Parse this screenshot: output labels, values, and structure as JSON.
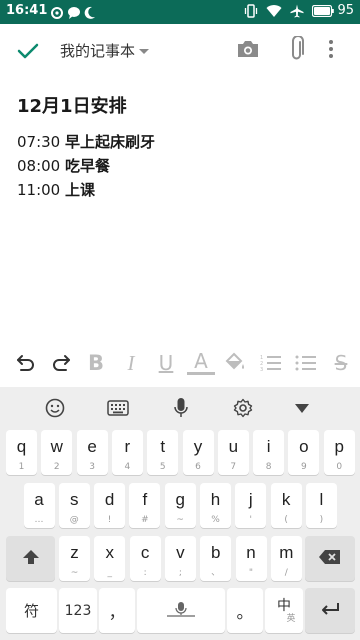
{
  "status_bar": {
    "time": "16:41",
    "battery": "95",
    "left_icons": [
      "sync-icon",
      "chat-bubble-icon",
      "moon-icon"
    ],
    "right_icons": [
      "vibrate-icon",
      "wifi-icon",
      "airplane-icon",
      "battery-icon"
    ]
  },
  "toolbar": {
    "notebook_name": "我的记事本",
    "icons": [
      "check-icon",
      "dropdown-caret-icon",
      "camera-icon",
      "paperclip-icon",
      "more-vert-icon"
    ]
  },
  "note": {
    "title": "12月1日安排",
    "lines": [
      {
        "time": "07:30",
        "task": "早上起床刷牙"
      },
      {
        "time": "08:00",
        "task": "吃早餐"
      },
      {
        "time": "11:00",
        "task": "上课"
      }
    ]
  },
  "format_bar": {
    "icons": [
      "undo-icon",
      "redo-icon",
      "bold-icon",
      "italic-icon",
      "underline-icon",
      "text-color-icon",
      "fill-color-icon",
      "numbered-list-icon",
      "bullet-list-icon",
      "strikethrough-icon"
    ],
    "glyphs": {
      "bold": "B",
      "italic": "I",
      "underline": "U",
      "text_color": "A",
      "strike": "S"
    }
  },
  "keyboard": {
    "top_icons": [
      "emoji-icon",
      "keyboard-icon",
      "microphone-icon",
      "settings-icon",
      "collapse-icon"
    ],
    "row1": [
      {
        "k": "q",
        "s": "1"
      },
      {
        "k": "w",
        "s": "2"
      },
      {
        "k": "e",
        "s": "3"
      },
      {
        "k": "r",
        "s": "4"
      },
      {
        "k": "t",
        "s": "5"
      },
      {
        "k": "y",
        "s": "6"
      },
      {
        "k": "u",
        "s": "7"
      },
      {
        "k": "i",
        "s": "8"
      },
      {
        "k": "o",
        "s": "9"
      },
      {
        "k": "p",
        "s": "0"
      }
    ],
    "row2": [
      {
        "k": "a",
        "s": "…"
      },
      {
        "k": "s",
        "s": "@"
      },
      {
        "k": "d",
        "s": "!"
      },
      {
        "k": "f",
        "s": "#"
      },
      {
        "k": "g",
        "s": "~"
      },
      {
        "k": "h",
        "s": "%"
      },
      {
        "k": "j",
        "s": "'"
      },
      {
        "k": "k",
        "s": "("
      },
      {
        "k": "l",
        "s": ")"
      }
    ],
    "row3": [
      {
        "k": "z",
        "s": "~"
      },
      {
        "k": "x",
        "s": "_"
      },
      {
        "k": "c",
        "s": ":"
      },
      {
        "k": "v",
        "s": ";"
      },
      {
        "k": "b",
        "s": "、"
      },
      {
        "k": "n",
        "s": "\""
      },
      {
        "k": "m",
        "s": "/"
      }
    ],
    "symbol_key": "符",
    "number_key": "123",
    "comma_key": "，",
    "period_key": "。",
    "lang_key": "中",
    "lang_sub": "英"
  }
}
